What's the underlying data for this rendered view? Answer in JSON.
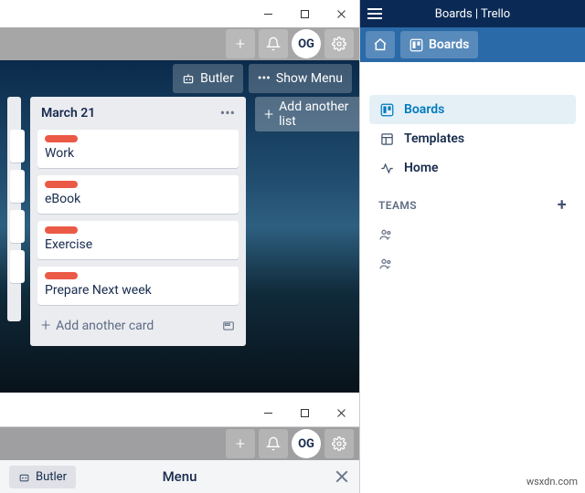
{
  "leftWindow": {
    "header": {
      "avatar": "OG"
    },
    "board": {
      "butler": "Butler",
      "showMenu": "Show Menu",
      "addAnotherList": "Add another list",
      "list": {
        "title": "March 21",
        "cards": [
          "Work",
          "eBook",
          "Exercise",
          "Prepare Next week"
        ],
        "addCard": "Add another card"
      }
    }
  },
  "lowerWindow": {
    "header": {
      "avatar": "OG"
    },
    "butler": "Butler",
    "menuTitle": "Menu"
  },
  "rightWindow": {
    "title": "Boards | Trello",
    "boardsBtn": "Boards",
    "nav": {
      "boards": "Boards",
      "templates": "Templates",
      "home": "Home"
    },
    "teamsHeader": "TEAMS"
  },
  "watermark": "wsxdn.com"
}
